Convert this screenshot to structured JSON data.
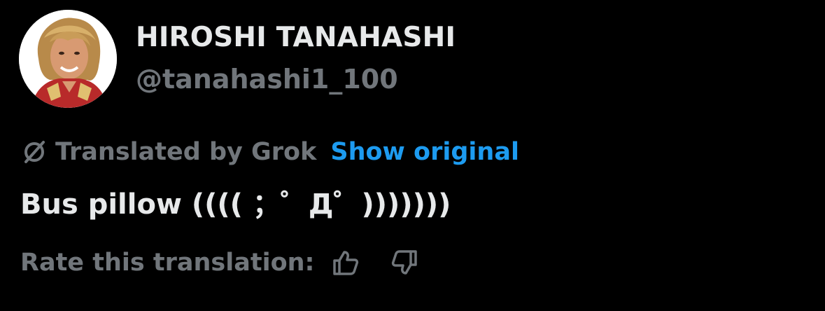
{
  "user": {
    "display_name": "HIROSHI TANAHASHI",
    "handle": "@tanahashi1_100"
  },
  "translation": {
    "icon": "no-entry-icon",
    "label": "Translated by Grok",
    "show_original_label": "Show original"
  },
  "post": {
    "text": "Bus pillow (((( ；゜Д゜)))))))"
  },
  "rating": {
    "label": "Rate this translation:",
    "thumbs_up_icon": "thumbs-up-icon",
    "thumbs_down_icon": "thumbs-down-icon"
  },
  "colors": {
    "background": "#000000",
    "primary_text": "#e7e9ea",
    "secondary_text": "#71767b",
    "link": "#1d9bf0"
  }
}
